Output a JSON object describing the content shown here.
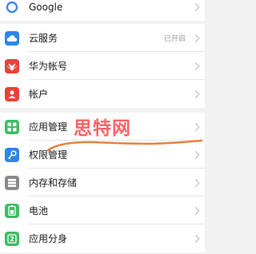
{
  "groups": [
    {
      "items": [
        {
          "label": "Google",
          "icon": "google-icon"
        }
      ]
    },
    {
      "items": [
        {
          "label": "云服务",
          "value": "已开启",
          "icon": "cloud-icon",
          "color": "#2b87e8"
        },
        {
          "label": "华为帐号",
          "icon": "huawei-icon",
          "color": "#e8423a"
        },
        {
          "label": "帐户",
          "icon": "account-icon",
          "color": "#e8423a"
        }
      ]
    },
    {
      "items": [
        {
          "label": "应用管理",
          "icon": "apps-icon",
          "color": "#3dbd62"
        },
        {
          "label": "权限管理",
          "icon": "key-icon",
          "color": "#2b87e8"
        },
        {
          "label": "内存和存储",
          "icon": "storage-icon",
          "color": "#8a8a8a"
        },
        {
          "label": "电池",
          "icon": "battery-icon",
          "color": "#3dbd62"
        },
        {
          "label": "应用分身",
          "icon": "app-twin-icon",
          "color": "#3dbd62"
        }
      ]
    }
  ],
  "watermark": "思特网",
  "annotation_color": "#e8823a"
}
